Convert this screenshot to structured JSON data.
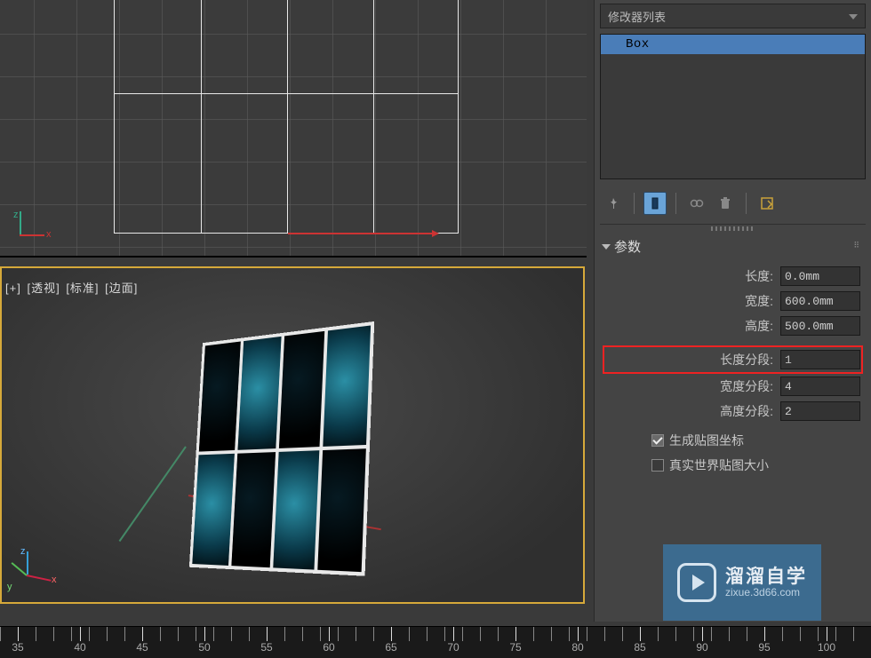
{
  "viewport": {
    "persp_labels": [
      "[+]",
      "[透视]",
      "[标准]",
      "[边面]"
    ]
  },
  "modifier": {
    "dropdown_label": "修改器列表",
    "stack_item": "Box"
  },
  "toolbar_icons": {
    "pin": "pin-icon",
    "showend": "show-end-result-icon",
    "unique": "make-unique-icon",
    "remove": "remove-modifier-icon",
    "configure": "configure-sets-icon"
  },
  "rollout": {
    "title": "参数"
  },
  "params": {
    "length_label": "长度:",
    "length_value": "0.0mm",
    "width_label": "宽度:",
    "width_value": "600.0mm",
    "height_label": "高度:",
    "height_value": "500.0mm",
    "lsegs_label": "长度分段:",
    "lsegs_value": "1",
    "wsegs_label": "宽度分段:",
    "wsegs_value": "4",
    "hsegs_label": "高度分段:",
    "hsegs_value": "2",
    "genmap_label": "生成贴图坐标",
    "realworld_label": "真实世界贴图大小"
  },
  "timeline": {
    "labels": [
      "35",
      "40",
      "45",
      "50",
      "55",
      "60",
      "65",
      "70",
      "75",
      "80",
      "85",
      "90",
      "95",
      "100"
    ]
  },
  "watermark": {
    "title": "溜溜自学",
    "sub": "zixue.3d66.com"
  }
}
